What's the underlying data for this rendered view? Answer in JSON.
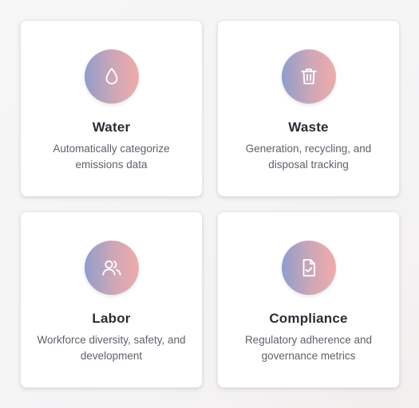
{
  "cards": [
    {
      "icon": "water-drop-icon",
      "title": "Water",
      "description": "Automatically categorize emissions data"
    },
    {
      "icon": "trash-icon",
      "title": "Waste",
      "description": "Generation, recycling, and disposal tracking"
    },
    {
      "icon": "users-icon",
      "title": "Labor",
      "description": "Workforce diversity, safety, and development"
    },
    {
      "icon": "file-check-icon",
      "title": "Compliance",
      "description": "Regulatory adherence and governance metrics"
    }
  ],
  "colors": {
    "gradient_start": "#909dcc",
    "gradient_end": "#f0abab",
    "title": "#2b2d35",
    "description": "#5f626b"
  }
}
